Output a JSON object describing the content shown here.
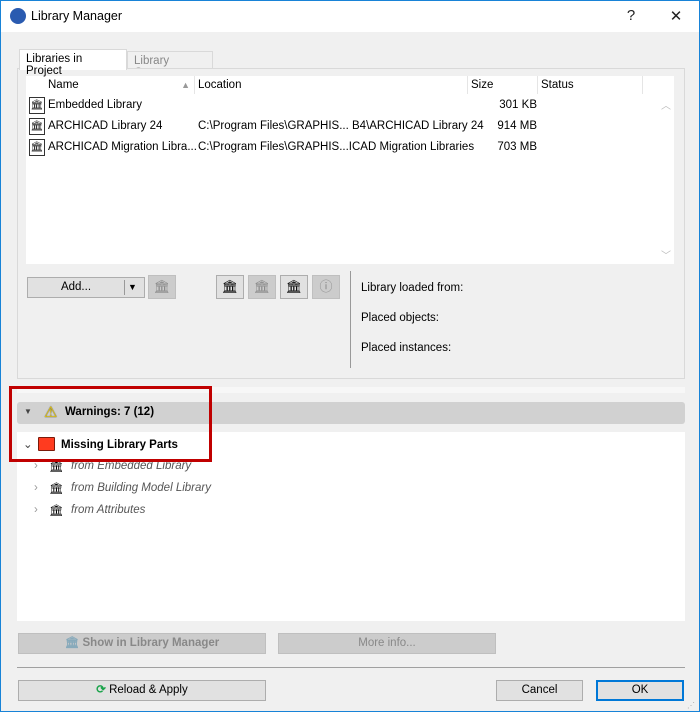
{
  "window": {
    "title": "Library Manager",
    "help_label": "?",
    "close_label": "✕"
  },
  "tabs": [
    {
      "label": "Libraries in Project",
      "active": true
    },
    {
      "label": "Library Content",
      "active": false
    }
  ],
  "table": {
    "columns": [
      "Name",
      "Location",
      "Size",
      "Status"
    ],
    "sort_column": "Name",
    "rows": [
      {
        "name": "Embedded Library",
        "location": "",
        "size": "301 KB",
        "status": ""
      },
      {
        "name": "ARCHICAD Library 24",
        "location": "C:\\Program Files\\GRAPHIS... B4\\ARCHICAD Library 24",
        "size": "914 MB",
        "status": ""
      },
      {
        "name": "ARCHICAD Migration Libra...",
        "location": "C:\\Program Files\\GRAPHIS...ICAD Migration Libraries",
        "size": "703 MB",
        "status": ""
      }
    ]
  },
  "toolbar": {
    "add_label": "Add...",
    "icons": [
      "remove-library-icon",
      "add-server-library-icon",
      "embed-library-icon",
      "reload-library-icon",
      "info-icon"
    ]
  },
  "info": {
    "loaded_from": "Library loaded from:",
    "placed_objects": "Placed objects:",
    "placed_instances": "Placed instances:"
  },
  "warnings": {
    "label": "Warnings: 7 (12)",
    "group": "Missing Library Parts",
    "group_color": "#ff3b1f",
    "children": [
      "from Embedded Library",
      "from Building Model Library",
      "from Attributes"
    ]
  },
  "buttons": {
    "show": "Show in Library Manager",
    "more": "More info...",
    "reload": "Reload & Apply",
    "cancel": "Cancel",
    "ok": "OK"
  },
  "colors": {
    "accent": "#0078d7",
    "highlight": "#c00000"
  }
}
